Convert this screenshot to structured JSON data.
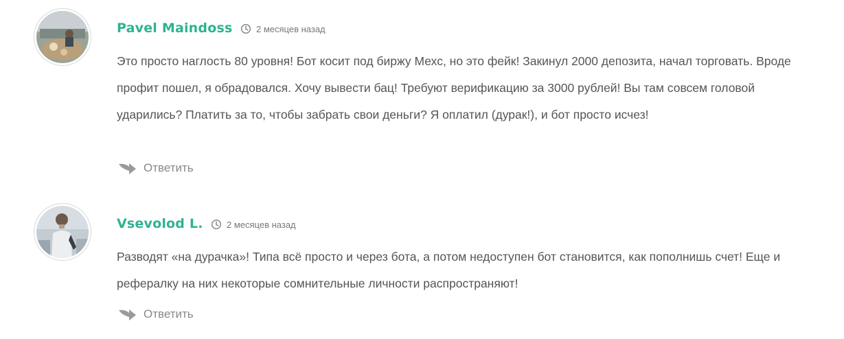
{
  "comments": [
    {
      "author": "Pavel Maindoss",
      "time": "2 месяцев назад",
      "text": "Это просто наглость 80 уровня! Бот косит под биржу Мехс, но это фейк! Закинул 2000 депозита, начал торговать. Вроде профит пошел, я обрадовался. Хочу вывести бац! Требуют верификацию за 3000 рублей! Вы там совсем головой ударились? Платить за то, чтобы забрать свои деньги? Я оплатил (дурак!), и бот просто исчез!",
      "reply_label": "Ответить"
    },
    {
      "author": "Vsevolod L.",
      "time": "2 месяцев назад",
      "text": "Разводят «на дурачка»! Типа всё просто и через бота, а потом недоступен бот становится, как пополнишь счет! Еще и рефералку на них некоторые сомнительные личности распространяют!",
      "reply_label": "Ответить"
    }
  ],
  "colors": {
    "author": "#2eb391",
    "text": "#555555",
    "meta": "#777777",
    "reply": "#888888"
  },
  "icons": {
    "time": "clock-icon",
    "reply": "reply-arrow-icon"
  }
}
